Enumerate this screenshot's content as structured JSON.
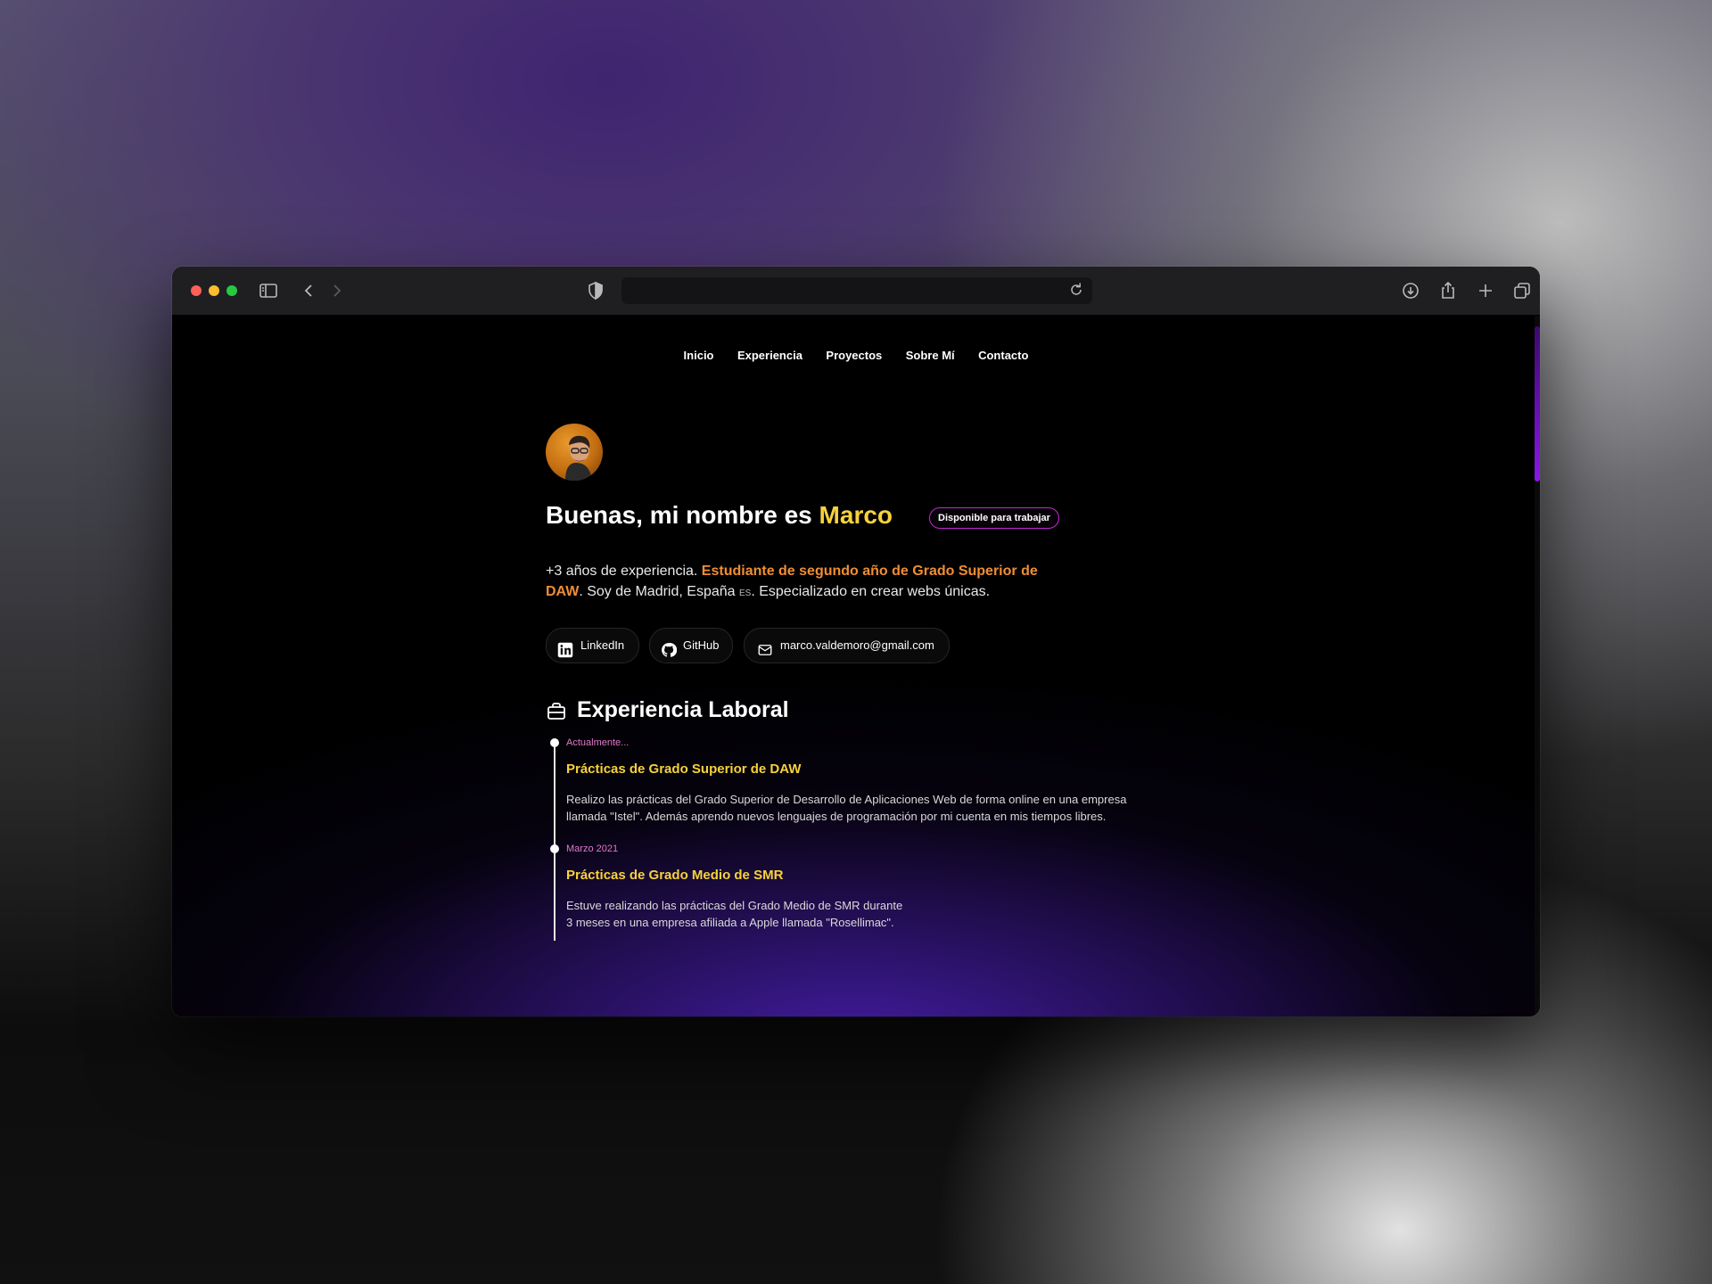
{
  "browser": {
    "traffic_lights": [
      "#fe5f57",
      "#febc2e",
      "#28c840"
    ],
    "url": ""
  },
  "nav": {
    "items": [
      "Inicio",
      "Experiencia",
      "Proyectos",
      "Sobre Mí",
      "Contacto"
    ]
  },
  "hero": {
    "title_prefix": "Buenas, mi nombre es",
    "title_name": "Marco",
    "badge": "Disponible para trabajar",
    "bio_part1": "+3 años de experiencia.",
    "bio_highlight": "Estudiante de segundo año de Grado Superior de DAW",
    "bio_part2": ". Soy de Madrid, España",
    "bio_flag": "ES",
    "bio_part3": ". Especializado en crear webs únicas."
  },
  "social_links": [
    {
      "label": "LinkedIn",
      "icon": "linkedin-icon"
    },
    {
      "label": "GitHub",
      "icon": "github-icon"
    },
    {
      "label": "marco.valdemoro@gmail.com",
      "icon": "mail-icon"
    }
  ],
  "experience": {
    "title": "Experiencia Laboral",
    "items": [
      {
        "date": "Actualmente...",
        "title": "Prácticas de Grado Superior de DAW",
        "desc_line1": "Realizo las prácticas del Grado Superior de Desarrollo de Aplicaciones Web de forma online en una empresa",
        "desc_line2": "llamada \"Istel\". Además aprendo nuevos lenguajes de programación por mi cuenta en mis tiempos libres."
      },
      {
        "date": "Marzo 2021",
        "title": "Prácticas de Grado Medio de SMR",
        "desc_line1": "Estuve realizando las prácticas del Grado Medio de SMR durante",
        "desc_line2": "3 meses en una empresa afiliada a Apple llamada \"Rosellimac\"."
      }
    ]
  },
  "colors": {
    "accent_yellow": "#f7d23a",
    "accent_orange": "#f08e33",
    "accent_pink": "#e07ac8",
    "badge_border": "#c12ad1",
    "gradient_purple": "#4a1fb0"
  }
}
